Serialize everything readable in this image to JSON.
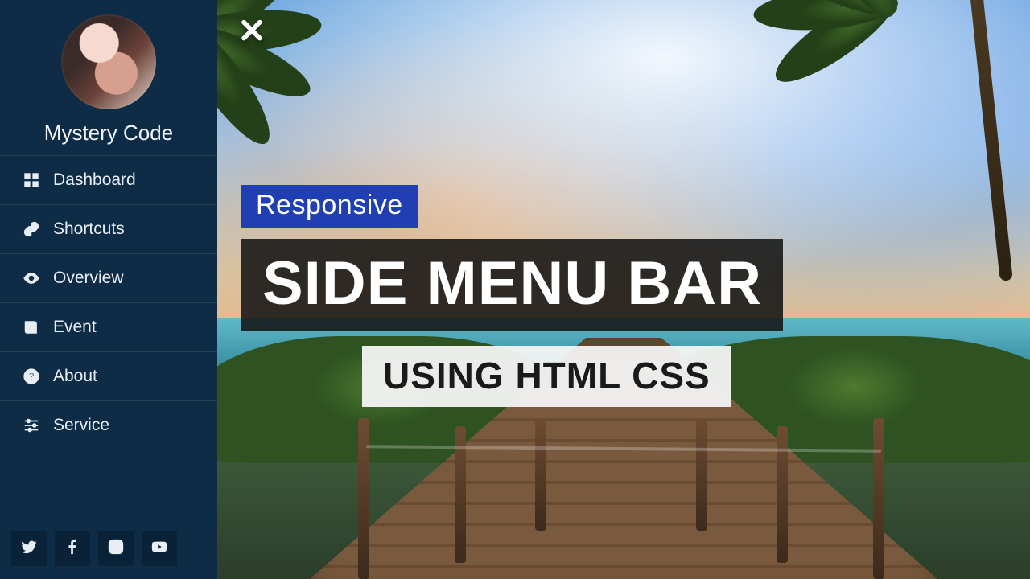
{
  "sidebar": {
    "username": "Mystery Code",
    "items": [
      {
        "label": "Dashboard",
        "icon": "grid-icon"
      },
      {
        "label": "Shortcuts",
        "icon": "link-icon"
      },
      {
        "label": "Overview",
        "icon": "eye-icon"
      },
      {
        "label": "Event",
        "icon": "book-icon"
      },
      {
        "label": "About",
        "icon": "question-icon"
      },
      {
        "label": "Service",
        "icon": "sliders-icon"
      }
    ],
    "socials": [
      {
        "name": "twitter-icon"
      },
      {
        "name": "facebook-icon"
      },
      {
        "name": "instagram-icon"
      },
      {
        "name": "youtube-icon"
      }
    ]
  },
  "hero": {
    "badge": "Responsive",
    "title": "SIDE MENU BAR",
    "subtitle": "USING HTML CSS",
    "close_icon": "close-icon"
  }
}
